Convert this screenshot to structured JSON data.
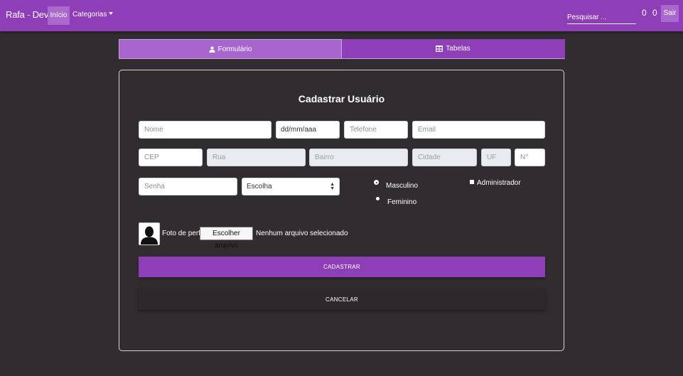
{
  "navbar": {
    "brand": "Rafa - Dev",
    "home_label": "Início",
    "categories_label": "Categorias",
    "search_placeholder": "Pesquisar ...",
    "counter_a": "0",
    "counter_b": "0",
    "exit_label": "Sair",
    "bg_color": "#8e3fb8"
  },
  "tabs": [
    {
      "label": "Formulário",
      "icon": "user-icon"
    },
    {
      "label": "Tabelas",
      "icon": "table-icon"
    }
  ],
  "form": {
    "title": "Cadastrar Usuário",
    "name_placeholder": "Nome",
    "date_value": "dd/mm/aaa",
    "phone_placeholder": "Telefone",
    "email_placeholder": "Email",
    "cep_placeholder": "CEP",
    "street_placeholder": "Rua",
    "district_placeholder": "Bairro",
    "city_placeholder": "Cidade",
    "state_placeholder": "UF",
    "number_placeholder": "N°",
    "password_placeholder": "Senha",
    "select_value": "Escolha",
    "radio_male": "Masculino",
    "radio_female": "Feminino",
    "checkbox_admin": "Administrador",
    "photo_label": "Foto de perfil",
    "file_button": "Escolher arquivo",
    "file_status": "Nenhum arquivo selecionado",
    "submit_label": "CADASTRAR",
    "cancel_label": "CANCELAR"
  }
}
